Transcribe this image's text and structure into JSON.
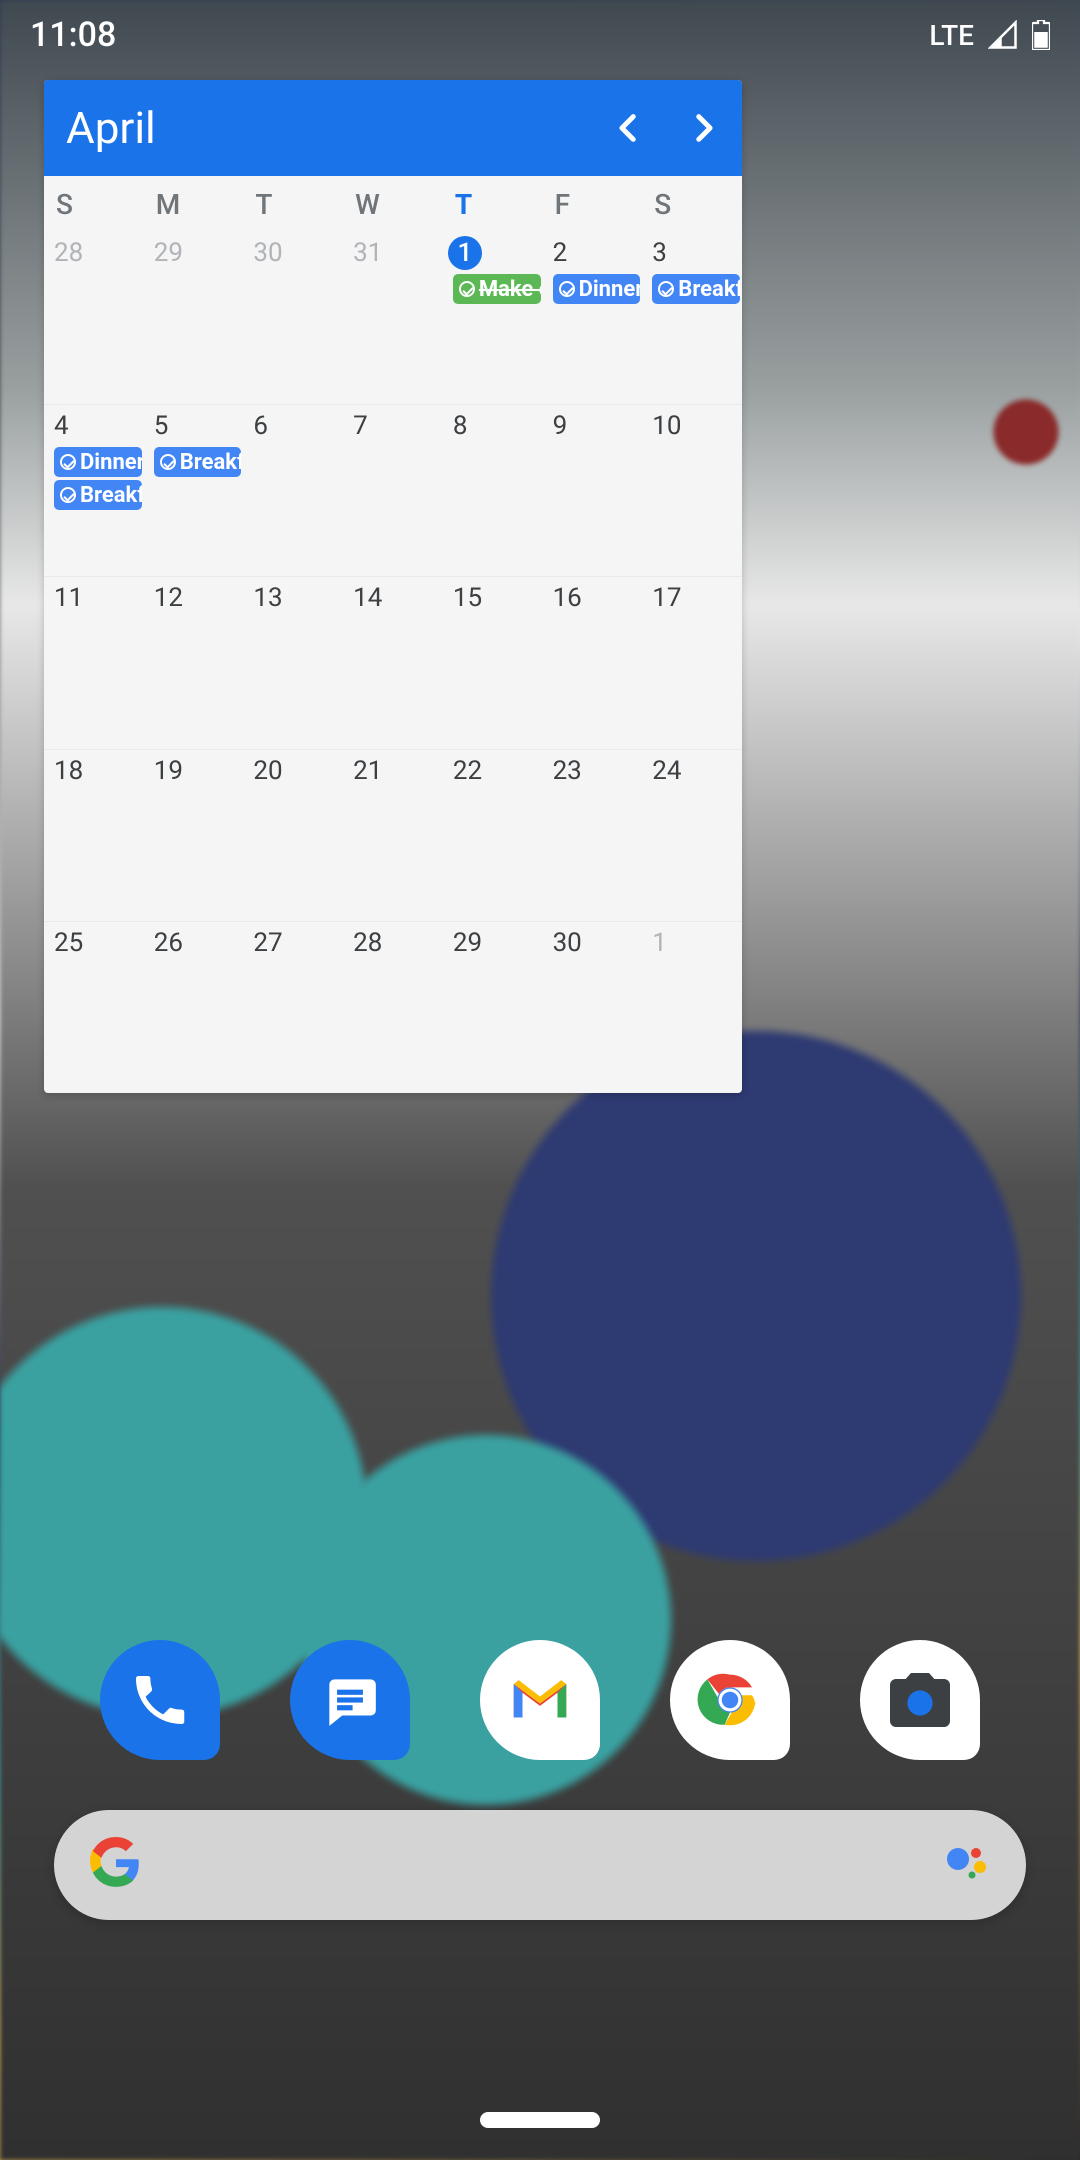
{
  "status": {
    "time": "11:08",
    "network": "LTE"
  },
  "calendar": {
    "month": "April",
    "dow": [
      "S",
      "M",
      "T",
      "W",
      "T",
      "F",
      "S"
    ],
    "todayCol": 4,
    "weeks": [
      [
        {
          "n": "28",
          "muted": true
        },
        {
          "n": "29",
          "muted": true
        },
        {
          "n": "30",
          "muted": true
        },
        {
          "n": "31",
          "muted": true
        },
        {
          "n": "1",
          "today": true,
          "events": [
            {
              "t": "Make e",
              "c": "green",
              "done": true
            }
          ]
        },
        {
          "n": "2",
          "events": [
            {
              "t": "Dinner:",
              "c": "blue"
            }
          ]
        },
        {
          "n": "3",
          "events": [
            {
              "t": "Breakfa",
              "c": "blue"
            }
          ]
        }
      ],
      [
        {
          "n": "4",
          "events": [
            {
              "t": "Dinner:",
              "c": "blue"
            },
            {
              "t": "Breakfa",
              "c": "blue"
            }
          ]
        },
        {
          "n": "5",
          "events": [
            {
              "t": "Breakfa",
              "c": "blue"
            }
          ]
        },
        {
          "n": "6"
        },
        {
          "n": "7"
        },
        {
          "n": "8"
        },
        {
          "n": "9"
        },
        {
          "n": "10"
        }
      ],
      [
        {
          "n": "11"
        },
        {
          "n": "12"
        },
        {
          "n": "13"
        },
        {
          "n": "14"
        },
        {
          "n": "15"
        },
        {
          "n": "16"
        },
        {
          "n": "17"
        }
      ],
      [
        {
          "n": "18"
        },
        {
          "n": "19"
        },
        {
          "n": "20"
        },
        {
          "n": "21"
        },
        {
          "n": "22"
        },
        {
          "n": "23"
        },
        {
          "n": "24"
        }
      ],
      [
        {
          "n": "25"
        },
        {
          "n": "26"
        },
        {
          "n": "27"
        },
        {
          "n": "28"
        },
        {
          "n": "29"
        },
        {
          "n": "30"
        },
        {
          "n": "1",
          "muted": true
        }
      ]
    ]
  },
  "dock": {
    "apps": [
      "phone",
      "messages",
      "gmail",
      "chrome",
      "camera"
    ]
  }
}
